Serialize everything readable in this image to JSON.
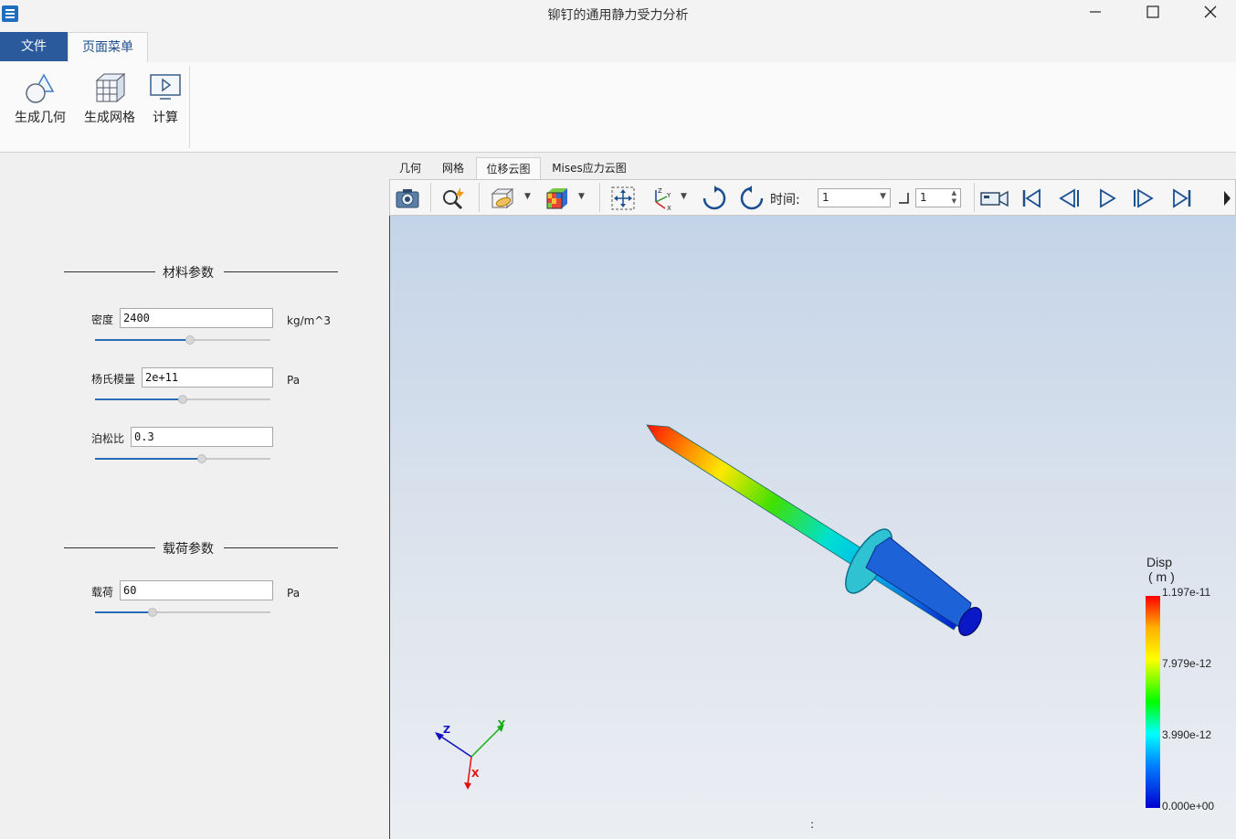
{
  "window": {
    "title": "铆钉的通用静力受力分析",
    "min_icon": "minimize-icon",
    "max_icon": "maximize-icon",
    "close_icon": "close-icon"
  },
  "menu_tabs": {
    "file": "文件",
    "page_menu": "页面菜单"
  },
  "ribbon": {
    "geometry": "生成几何",
    "mesh": "生成网格",
    "compute": "计算"
  },
  "materials": {
    "title": "材料参数",
    "density": {
      "label": "密度",
      "value": "2400",
      "unit": "kg/m^3",
      "slider": 0.54
    },
    "youngs": {
      "label": "杨氏模量",
      "value": "2e+11",
      "unit": "Pa",
      "slider": 0.5
    },
    "poisson": {
      "label": "泊松比",
      "value": "0.3",
      "unit": "",
      "slider": 0.61
    }
  },
  "loads": {
    "title": "载荷参数",
    "load": {
      "label": "载荷",
      "value": "60",
      "unit": "Pa",
      "slider": 0.33
    }
  },
  "view_tabs": [
    "几何",
    "网格",
    "位移云图",
    "Mises应力云图"
  ],
  "view_tab_active": 2,
  "toolbar": {
    "time_label": "时间:",
    "time_value": "1",
    "step_value": "1"
  },
  "legend": {
    "title": "Disp",
    "unit": "( m )",
    "max": "1.197e-11",
    "t2": "7.979e-12",
    "t1": "3.990e-12",
    "min": "0.000e+00"
  },
  "axes": {
    "x": "X",
    "y": "Y",
    "z": "Z"
  },
  "status_text": ":",
  "colors": {
    "accent": "#2a5a9c",
    "slider_fill": "#2a6bb5"
  }
}
